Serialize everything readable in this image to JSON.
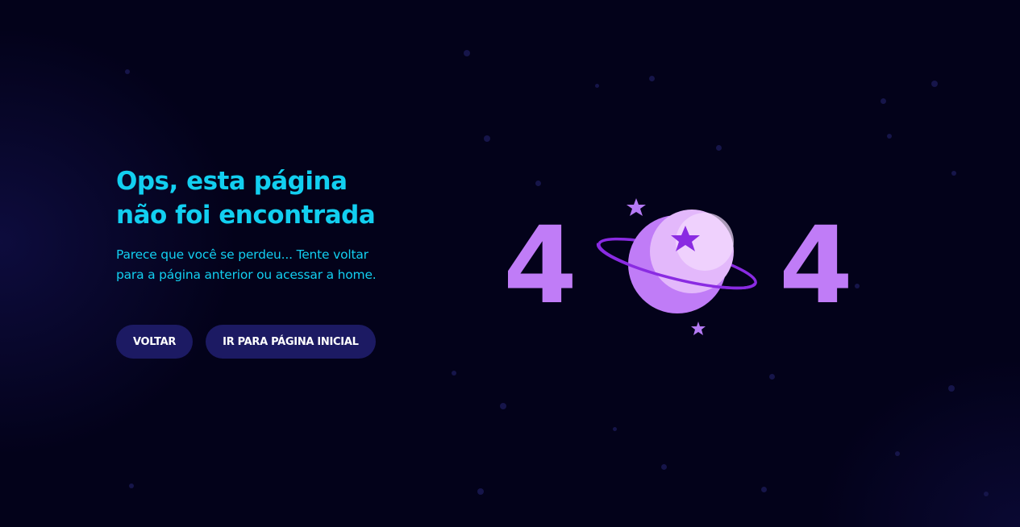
{
  "title": {
    "line1": "Ops, esta página",
    "line2": "não foi encontrada"
  },
  "description": {
    "line1": "Parece que você se perdeu... Tente voltar",
    "line2": "para a página anterior ou acessar a home."
  },
  "buttons": {
    "back_label": "VOLTAR",
    "home_label": "IR PARA PÁGINA INICIAL"
  },
  "illustration": {
    "left_digit": "4",
    "right_digit": "4",
    "planet_icon": "planet-with-ring-icon",
    "star_icon": "star-icon"
  },
  "colors": {
    "background": "#03021a",
    "accent": "#12cff0",
    "button": "#1c1a63",
    "purple": "#c07cf7"
  }
}
